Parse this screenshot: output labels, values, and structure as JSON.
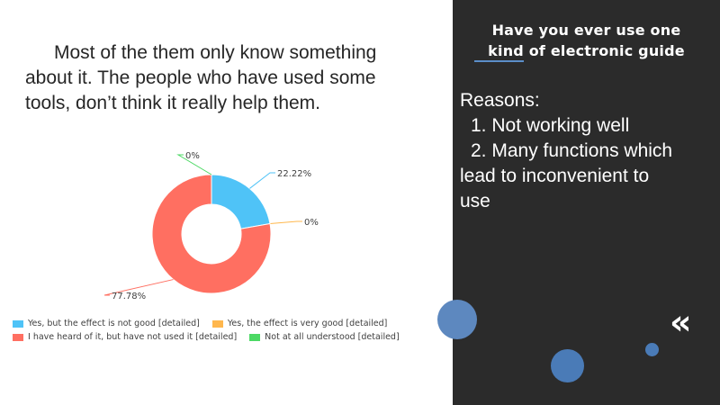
{
  "left_text": "Most of the them only know something about it. The people who have used some tools, don’t think it really help them.",
  "panel": {
    "title_line1": "Have you ever use one",
    "title_line2": "kind of electronic guide",
    "reasons_heading": "Reasons:",
    "reason_1": "1. Not working  well",
    "reason_2_line1": "2. Many functions which",
    "reason_2_line2": "lead to inconvenient  to",
    "reason_2_line3": "use",
    "quote_mark": "«"
  },
  "colors": {
    "panel_bg": "#2b2b2b",
    "accent_circle": "#4a7bb7",
    "series_blue": "#4fc3f7",
    "series_orange": "#ffb74d",
    "series_red": "#ff6f61",
    "series_green": "#4cd964"
  },
  "chart_data": {
    "type": "pie",
    "variant": "donut",
    "slices": [
      {
        "name": "Yes, but the effect is not good  [detailed]",
        "value": 22.22,
        "label": "22.22%",
        "color": "#4fc3f7"
      },
      {
        "name": "Yes, the effect is very good  [detailed]",
        "value": 0,
        "label": "0%",
        "color": "#ffb74d"
      },
      {
        "name": "I have heard of it, but have not used it  [detailed]",
        "value": 77.78,
        "label": "77.78%",
        "color": "#ff6f61"
      },
      {
        "name": "Not at all understood  [detailed]",
        "value": 0,
        "label": "0%",
        "color": "#4cd964"
      }
    ],
    "legend_placement": "bottom"
  }
}
